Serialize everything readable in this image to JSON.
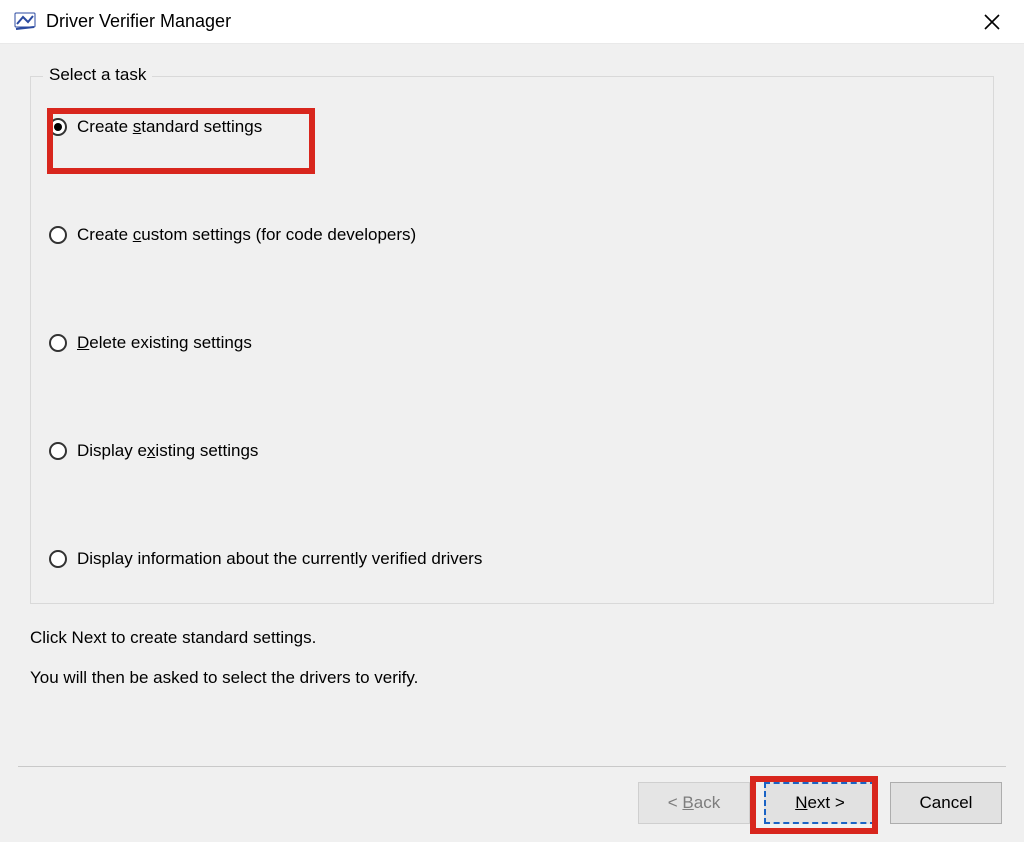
{
  "window": {
    "title": "Driver Verifier Manager"
  },
  "group": {
    "legend": "Select a task"
  },
  "options": {
    "create_standard": {
      "pre": "Create ",
      "u": "s",
      "post": "tandard settings",
      "selected": true
    },
    "create_custom": {
      "pre": "Create ",
      "u": "c",
      "post": "ustom settings (for code developers)",
      "selected": false
    },
    "delete_existing": {
      "pre": "",
      "u": "D",
      "post": "elete existing settings",
      "selected": false
    },
    "display_existing": {
      "pre": "Display e",
      "u": "x",
      "post": "isting settings",
      "selected": false
    },
    "display_info": {
      "pre": "Display information about the currently verified drivers",
      "u": "",
      "post": "",
      "selected": false
    }
  },
  "instructions": {
    "line1": "Click Next to create standard settings.",
    "line2": "You will then be asked to select the drivers to verify."
  },
  "buttons": {
    "back": {
      "pre": "< ",
      "u": "B",
      "post": "ack"
    },
    "next": {
      "pre": "",
      "u": "N",
      "post": "ext >"
    },
    "cancel": "Cancel"
  }
}
